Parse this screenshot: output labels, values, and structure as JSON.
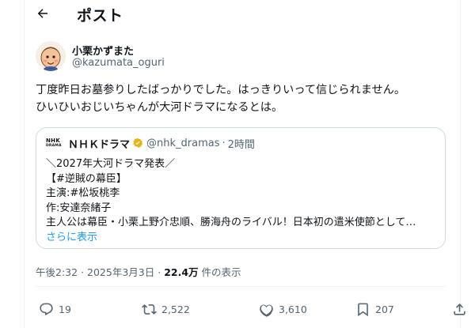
{
  "header": {
    "title": "ポスト"
  },
  "author": {
    "name": "小栗かずまた",
    "handle": "@kazumata_oguri"
  },
  "post": {
    "lines": [
      "丁度昨日お墓参りしたばっかりでした。はっきりいって信じられません。",
      "ひいひいおじいちゃんが大河ドラマになるとは。"
    ]
  },
  "quote": {
    "logo_top": "NHK",
    "logo_bottom": "DRAMA",
    "name": "ＮＨＫドラマ",
    "handle": "@nhk_dramas",
    "separator": "·",
    "time": "2時間",
    "lines": [
      "＼2027年大河ドラマ発表／",
      "【#逆賊の幕臣】",
      "主演:#松坂桃李",
      "作:安達奈緒子",
      "主人公は幕臣・小栗上野介忠順、勝海舟のライバル！日本初の遣米使節として…"
    ],
    "show_more": "さらに表示"
  },
  "meta": {
    "time": "午後2:32",
    "sep1": "·",
    "date": "2025年3月3日",
    "sep2": "·",
    "views": "22.4万",
    "views_label": "件の表示"
  },
  "actions": {
    "replies": "19",
    "reposts": "2,522",
    "likes": "3,610",
    "bookmarks": "207"
  },
  "icons": [
    "back-arrow-icon",
    "verified-gold-badge-icon",
    "reply-icon",
    "repost-icon",
    "like-icon",
    "bookmark-icon",
    "share-icon"
  ],
  "colors": {
    "accent": "#1d9bf0",
    "badge": "#e2b719",
    "muted": "#536471",
    "text": "#0f1419"
  }
}
